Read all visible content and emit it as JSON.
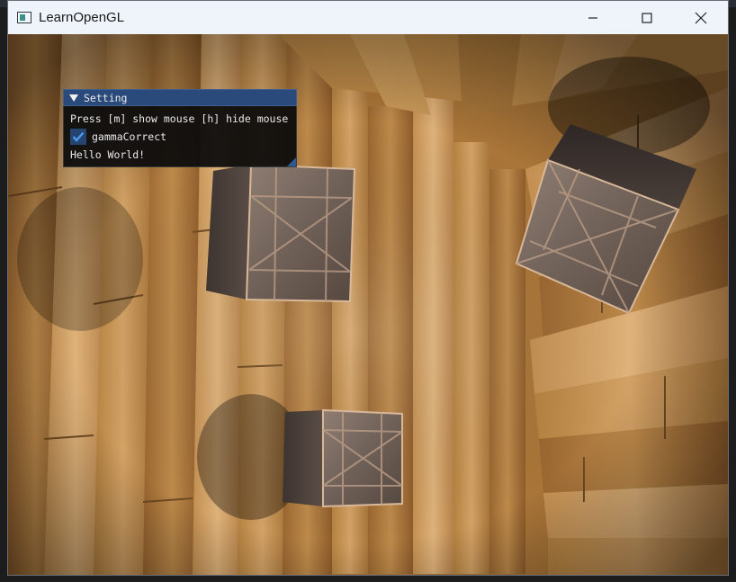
{
  "window": {
    "title": "LearnOpenGL",
    "controls": [
      "minimize",
      "maximize",
      "close"
    ]
  },
  "imgui": {
    "panel_title": "Setting",
    "help_text": "Press [m] show mouse [h] hide mouse",
    "checkbox": {
      "label": "gammaCorrect",
      "checked": true
    },
    "message": "Hello World!"
  },
  "icons": {
    "app": "window-app-icon",
    "minimize": "minimize-icon",
    "maximize": "maximize-icon",
    "close": "close-icon",
    "collapse": "collapse-triangle-icon",
    "check": "checkmark-icon"
  },
  "colors": {
    "titlebar": "#eef4f9",
    "imgui_title": "#294a7a",
    "imgui_check": "#25446f",
    "checkmark": "#4a9bf0",
    "wood_light": "#c99a5e",
    "wood_dark": "#6b4322"
  }
}
